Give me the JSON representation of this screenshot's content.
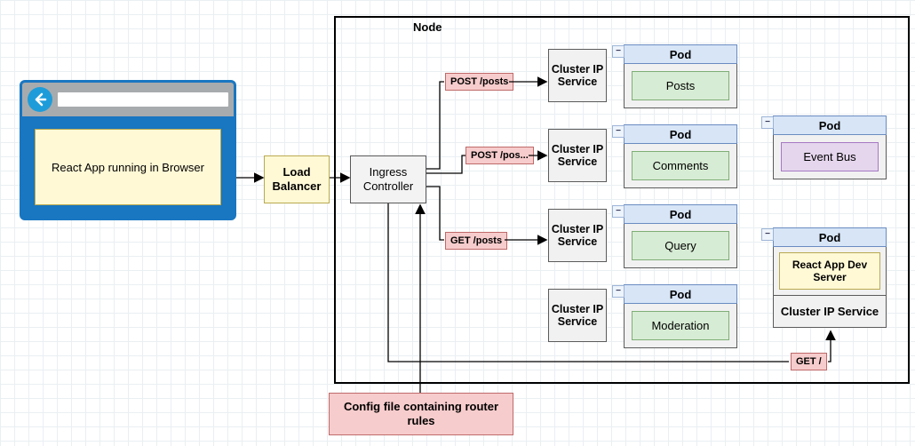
{
  "browser": {
    "label": "React App running in Browser"
  },
  "load_balancer": {
    "label": "Load Balancer"
  },
  "ingress": {
    "label": "Ingress Controller"
  },
  "config": {
    "label": "Config file containing router rules"
  },
  "node_label": "Node",
  "routes": {
    "post_posts": "POST /posts",
    "post_pos_trunc": "POST /pos...",
    "get_posts": "GET /posts",
    "get_root": "GET /"
  },
  "cis_label": "Cluster IP Service",
  "pod_label": "Pod",
  "pods": {
    "posts": "Posts",
    "comments": "Comments",
    "query": "Query",
    "moderation": "Moderation",
    "event_bus": "Event Bus",
    "react_dev": "React App Dev Server"
  },
  "collapse_glyph": "−"
}
